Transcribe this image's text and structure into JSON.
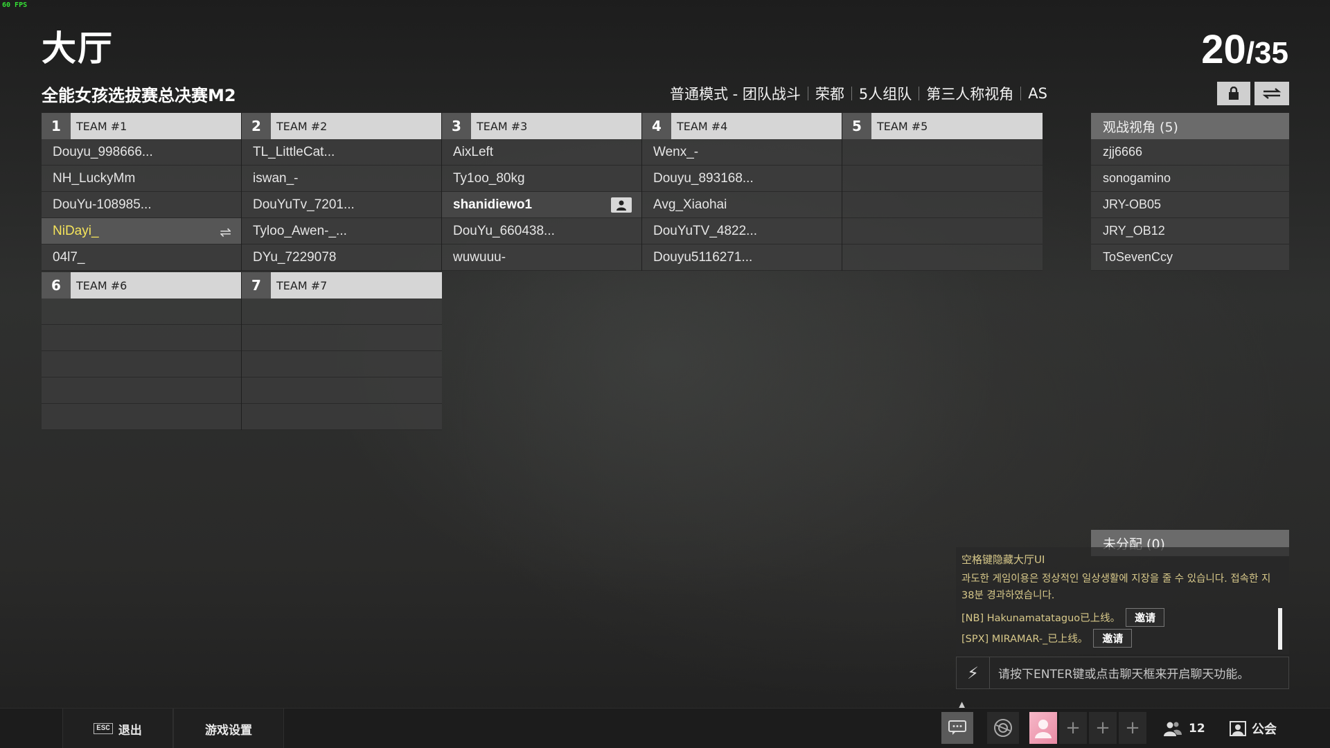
{
  "fps": "60 FPS",
  "lobby": {
    "title": "大厅",
    "count_current": "20",
    "count_sep": "/",
    "count_max": "35"
  },
  "room": {
    "name": "全能女孩选拔赛总决赛M2",
    "info": [
      "普通模式 - 团队战斗",
      "荣都",
      "5人组队",
      "第三人称视角",
      "AS"
    ]
  },
  "teams": [
    {
      "num": "1",
      "name": "TEAM #1",
      "players": [
        "Douyu_998666...",
        "NH_LuckyMm",
        "DouYu-108985...",
        "NiDayi_",
        "04l7_"
      ]
    },
    {
      "num": "2",
      "name": "TEAM #2",
      "players": [
        "TL_LittleCat...",
        "iswan_-",
        "DouYuTv_7201...",
        "Tyloo_Awen-_...",
        "DYu_7229078"
      ]
    },
    {
      "num": "3",
      "name": "TEAM #3",
      "players": [
        "AixLeft",
        "Ty1oo_80kg",
        "shanidiewo1",
        "DouYu_660438...",
        "wuwuuu-"
      ]
    },
    {
      "num": "4",
      "name": "TEAM #4",
      "players": [
        "Wenx_-",
        "Douyu_893168...",
        "Avg_Xiaohai",
        "DouYuTV_4822...",
        "Douyu5116271..."
      ]
    },
    {
      "num": "5",
      "name": "TEAM #5",
      "players": [
        "",
        "",
        "",
        "",
        ""
      ]
    },
    {
      "num": "6",
      "name": "TEAM #6",
      "players": [
        "",
        "",
        "",
        "",
        ""
      ]
    },
    {
      "num": "7",
      "name": "TEAM #7",
      "players": [
        "",
        "",
        "",
        "",
        ""
      ]
    }
  ],
  "spectators": {
    "header": "观战视角 (5)",
    "players": [
      "zjj6666",
      "sonogamino",
      "JRY-OB05",
      "JRY_OB12",
      "ToSevenCcy"
    ]
  },
  "unassigned": {
    "header": "未分配 (0)"
  },
  "chat": {
    "hint": "空格键隐藏大厅UI",
    "warning": "과도한 게임이용은 정상적인 일상생활에 지장을 줄 수 있습니다. 접속한 지 38분 경과하였습니다.",
    "lines": [
      {
        "text": "[NB] Hakunamatataguo已上线。",
        "button": "邀请"
      },
      {
        "text": "[SPX] MIRAMAR-_已上线。",
        "button": "邀请"
      }
    ],
    "input_placeholder": "请按下ENTER键或点击聊天框来开启聊天功能。"
  },
  "bottom": {
    "esc_key": "ESC",
    "exit": "退出",
    "settings": "游戏设置",
    "friends_count": "12",
    "guild": "公会"
  },
  "colors": {
    "highlight_player": "#f5e45b",
    "fps": "#35e035"
  }
}
